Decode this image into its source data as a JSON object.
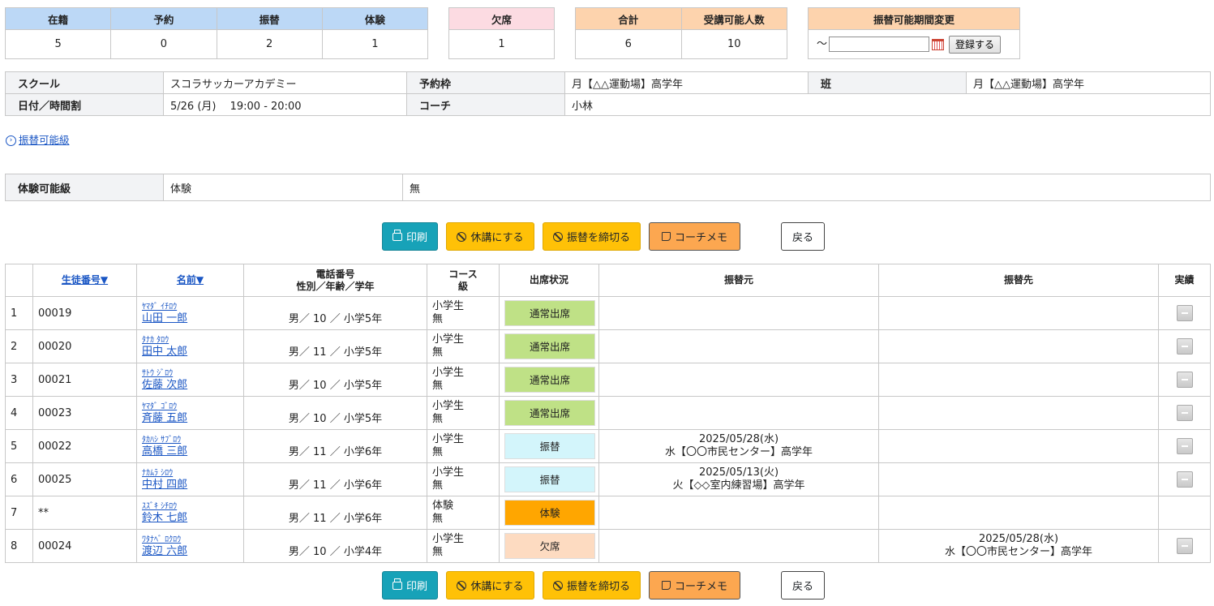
{
  "summary": {
    "enrolled": {
      "label": "在籍",
      "value": "5"
    },
    "reserved": {
      "label": "予約",
      "value": "0"
    },
    "transfer": {
      "label": "振替",
      "value": "2"
    },
    "trial": {
      "label": "体験",
      "value": "1"
    },
    "absent": {
      "label": "欠席",
      "value": "1"
    },
    "total": {
      "label": "合計",
      "value": "6"
    },
    "capacity": {
      "label": "受講可能人数",
      "value": "10"
    },
    "period_change": {
      "label": "振替可能期間変更",
      "tilde": "～",
      "input_value": "",
      "register_label": "登録する"
    }
  },
  "info": {
    "school_label": "スクール",
    "school": "スコラサッカーアカデミー",
    "slot_label": "予約枠",
    "slot": "月【△△運動場】高学年",
    "class_label": "班",
    "class": "月【△△運動場】高学年",
    "datetime_label": "日付／時間割",
    "datetime": "5/26 (月)　 19:00 - 20:00",
    "coach_label": "コーチ",
    "coach": "小林"
  },
  "transfer_link": "振替可能級",
  "trial_row": {
    "label": "体験可能級",
    "value1": "体験",
    "value2": "無"
  },
  "buttons": {
    "print": "印刷",
    "cancel_class": "休講にする",
    "close_transfer": "振替を締切る",
    "coach_memo": "コーチメモ",
    "back": "戻る"
  },
  "table": {
    "headers": {
      "no": "",
      "student_no": "生徒番号▼",
      "name": "名前▼",
      "phone": "電話番号",
      "demographic": "性別／年齢／学年",
      "course": "コース",
      "grade": "級",
      "attendance": "出席状況",
      "from": "振替元",
      "to": "振替先",
      "result": "実績"
    },
    "rows": [
      {
        "no": "1",
        "id": "00019",
        "kana": "ﾔﾏﾀﾞ ｲﾁﾛｳ",
        "name": "山田 一郎",
        "demo": "男／ 10 ／ 小学5年",
        "course": "小学生",
        "grade": "無",
        "status": "通常出席",
        "status_type": "normal",
        "from_date": "",
        "from_place": "",
        "to_date": "",
        "to_place": "",
        "result_btn": true
      },
      {
        "no": "2",
        "id": "00020",
        "kana": "ﾀﾅｶ ﾀﾛｳ",
        "name": "田中 太郎",
        "demo": "男／ 11 ／ 小学5年",
        "course": "小学生",
        "grade": "無",
        "status": "通常出席",
        "status_type": "normal",
        "from_date": "",
        "from_place": "",
        "to_date": "",
        "to_place": "",
        "result_btn": true
      },
      {
        "no": "3",
        "id": "00021",
        "kana": "ｻﾄｳ ｼﾞﾛｳ",
        "name": "佐藤 次郎",
        "demo": "男／ 10 ／ 小学5年",
        "course": "小学生",
        "grade": "無",
        "status": "通常出席",
        "status_type": "normal",
        "from_date": "",
        "from_place": "",
        "to_date": "",
        "to_place": "",
        "result_btn": true
      },
      {
        "no": "4",
        "id": "00023",
        "kana": "ﾔﾏﾀﾞ ｺﾞﾛｳ",
        "name": "斉藤 五郎",
        "demo": "男／ 10 ／ 小学5年",
        "course": "小学生",
        "grade": "無",
        "status": "通常出席",
        "status_type": "normal",
        "from_date": "",
        "from_place": "",
        "to_date": "",
        "to_place": "",
        "result_btn": true
      },
      {
        "no": "5",
        "id": "00022",
        "kana": "ﾀｶﾊｼ ｻﾌﾞﾛｳ",
        "name": "高橋 三郎",
        "demo": "男／ 11 ／ 小学6年",
        "course": "小学生",
        "grade": "無",
        "status": "振替",
        "status_type": "sub",
        "from_date": "2025/05/28(水)",
        "from_place": "水【〇〇市民センター】高学年",
        "to_date": "",
        "to_place": "",
        "result_btn": true
      },
      {
        "no": "6",
        "id": "00025",
        "kana": "ﾅｶﾑﾗ ｼﾛｳ",
        "name": "中村 四郎",
        "demo": "男／ 11 ／ 小学6年",
        "course": "小学生",
        "grade": "無",
        "status": "振替",
        "status_type": "sub",
        "from_date": "2025/05/13(火)",
        "from_place": "火【◇◇室内練習場】高学年",
        "to_date": "",
        "to_place": "",
        "result_btn": true
      },
      {
        "no": "7",
        "id": "**",
        "kana": "ｽｽﾞｷ ｼﾁﾛｳ",
        "name": "鈴木 七郎",
        "demo": "男／ 11 ／ 小学6年",
        "course": "体験",
        "grade": "無",
        "status": "体験",
        "status_type": "trial",
        "from_date": "",
        "from_place": "",
        "to_date": "",
        "to_place": "",
        "result_btn": false
      },
      {
        "no": "8",
        "id": "00024",
        "kana": "ﾜﾀﾅﾍﾞ ﾛｸﾛｳ",
        "name": "渡辺 六郎",
        "demo": "男／ 10 ／ 小学4年",
        "course": "小学生",
        "grade": "無",
        "status": "欠席",
        "status_type": "abs",
        "from_date": "",
        "from_place": "",
        "to_date": "2025/05/28(水)",
        "to_place": "水【〇〇市民センター】高学年",
        "result_btn": true
      }
    ]
  }
}
